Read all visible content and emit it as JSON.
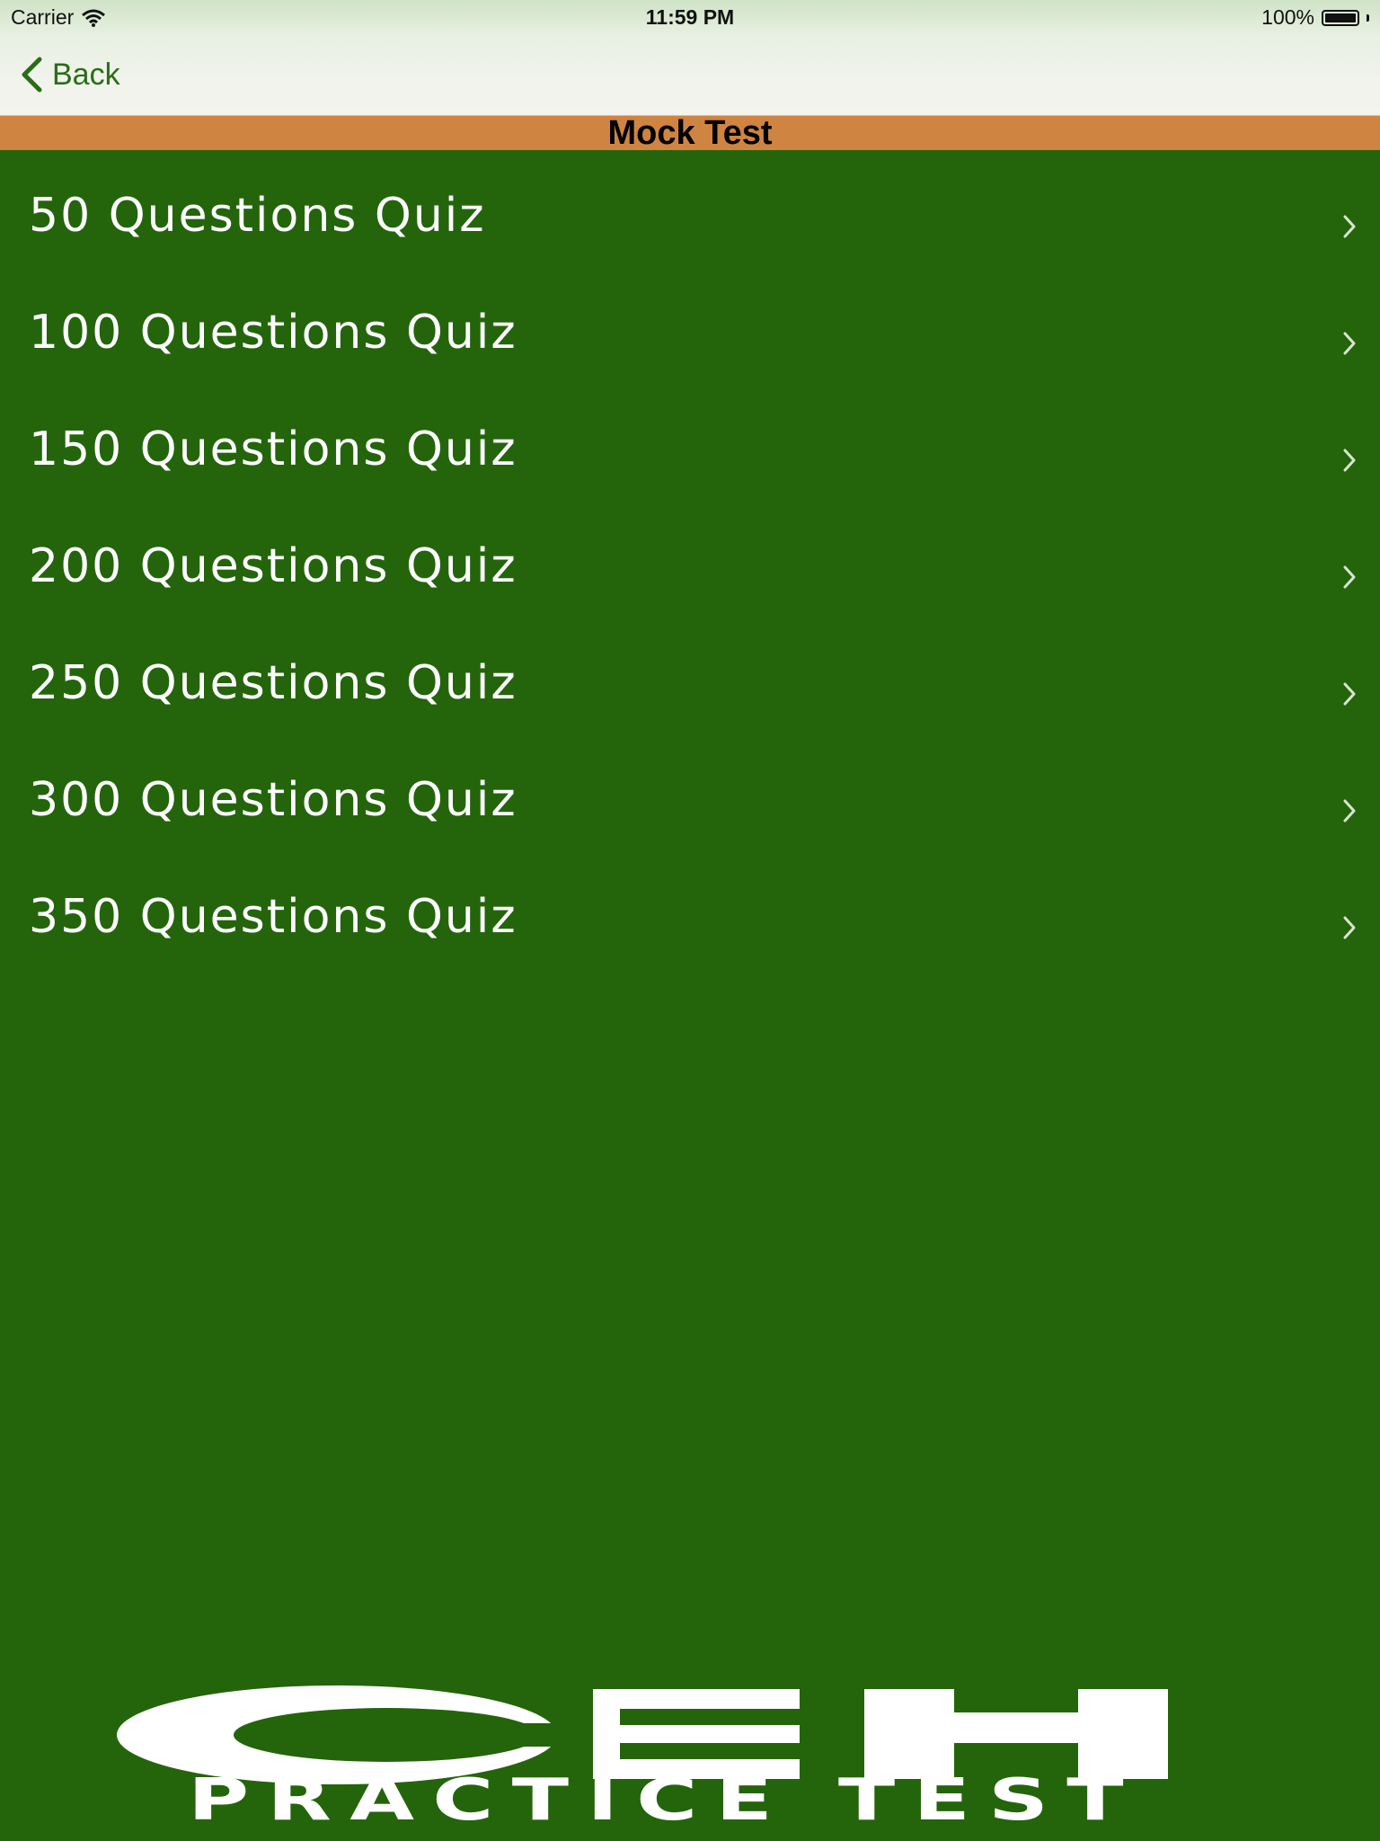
{
  "status_bar": {
    "carrier": "Carrier",
    "time": "11:59 PM",
    "battery_percent": "100%",
    "battery_level": 1.0
  },
  "nav": {
    "back_label": "Back",
    "title": "Mock Test"
  },
  "quiz_list": [
    {
      "label": "50 Questions Quiz"
    },
    {
      "label": "100 Questions Quiz"
    },
    {
      "label": "150 Questions Quiz"
    },
    {
      "label": "200 Questions Quiz"
    },
    {
      "label": "250 Questions Quiz"
    },
    {
      "label": "300 Questions Quiz"
    },
    {
      "label": "350 Questions Quiz"
    }
  ],
  "logo": {
    "letters": "CEH",
    "subtitle": "PRACTICE TEST"
  },
  "colors": {
    "background": "#24650c",
    "title_bar": "#cf8441",
    "accent": "#2a6d17",
    "text": "#ffffff"
  },
  "icons": {
    "back": "chevron-left-icon",
    "disclosure": "chevron-right-icon",
    "wifi": "wifi-icon",
    "battery": "battery-icon"
  }
}
